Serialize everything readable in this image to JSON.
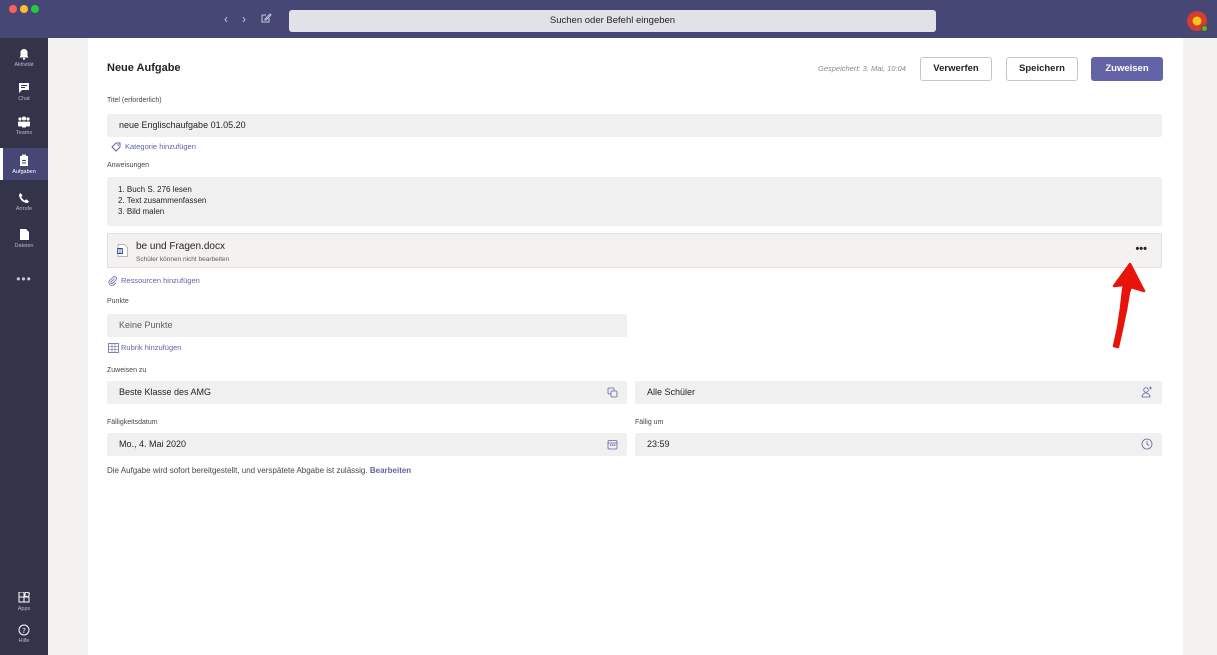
{
  "titlebar": {
    "search_placeholder": "Suchen oder Befehl eingeben",
    "back_icon": "‹",
    "forward_icon": "›"
  },
  "rail": {
    "items": [
      {
        "label": "Aktivität",
        "icon": "bell-icon"
      },
      {
        "label": "Chat",
        "icon": "chat-icon"
      },
      {
        "label": "Teams",
        "icon": "teams-icon"
      },
      {
        "label": "Aufgaben",
        "icon": "assignments-icon"
      },
      {
        "label": "Anrufe",
        "icon": "phone-icon"
      },
      {
        "label": "Dateien",
        "icon": "files-icon"
      }
    ],
    "more": "•••",
    "bottom": [
      {
        "label": "Apps",
        "icon": "apps-icon"
      },
      {
        "label": "Hilfe",
        "icon": "help-icon"
      }
    ]
  },
  "form": {
    "heading": "Neue Aufgabe",
    "saved_status": "Gespeichert: 3. Mai, 10:04",
    "discard_label": "Verwerfen",
    "save_label": "Speichern",
    "assign_label": "Zuweisen",
    "title_label": "Titel (erforderlich)",
    "title_value": "neue Englischaufgabe 01.05.20",
    "add_category": "Kategorie hinzufügen",
    "instructions_label": "Anweisungen",
    "instructions": [
      "1. Buch S. 276 lesen",
      "2. Text zusammenfassen",
      "3. Bild malen"
    ],
    "attachment": {
      "file_name": "be und Fragen.docx",
      "permission": "Schüler können nicht bearbeiten",
      "more": "•••"
    },
    "add_resources": "Ressourcen hinzufügen",
    "points_label": "Punkte",
    "points_value": "Keine Punkte",
    "add_rubric": "Rubrik hinzufügen",
    "assign_to_label": "Zuweisen zu",
    "class_value": "Beste Klasse des AMG",
    "students_value": "Alle Schüler",
    "due_date_label": "Fälligkeitsdatum",
    "due_date_value": "Mo., 4. Mai 2020",
    "due_time_label": "Fällig um",
    "due_time_value": "23:59",
    "footer_text": "Die Aufgabe wird sofort bereitgestellt, und verspätete Abgabe ist zulässig.",
    "footer_link": "Bearbeiten"
  },
  "colors": {
    "accent": "#6264a7",
    "titlebar": "#464775",
    "rail": "#33344a",
    "annotation_arrow": "#e8140c"
  }
}
